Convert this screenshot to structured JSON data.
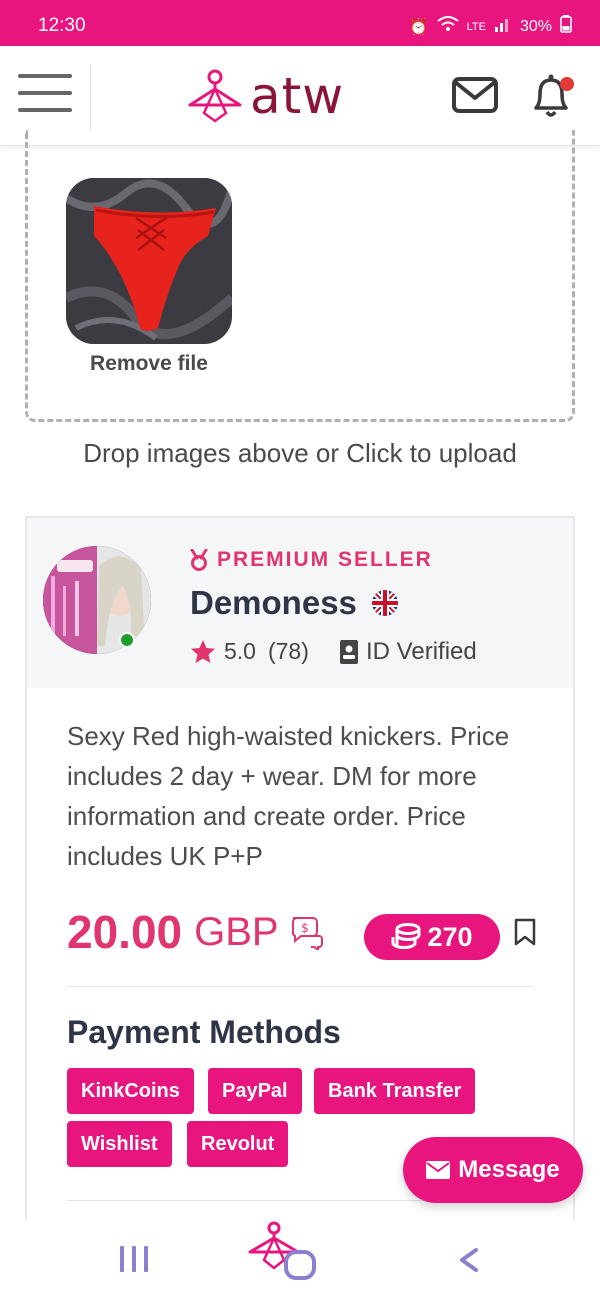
{
  "status_bar": {
    "time": "12:30",
    "network": "LTE",
    "battery": "30%"
  },
  "header": {
    "logo_text": "atw"
  },
  "upload": {
    "remove_label": "Remove file",
    "hint": "Drop images above or Click to upload"
  },
  "seller": {
    "badge": "PREMIUM SELLER",
    "name": "Demoness",
    "rating": "5.0",
    "review_count": "(78)",
    "verified_label": "ID Verified"
  },
  "listing": {
    "description": "Sexy Red high-waisted knickers. Price includes 2 day + wear. DM for more information and create order. Price includes UK P+P",
    "price_amount": "20.00",
    "price_currency": "GBP",
    "coins": "270"
  },
  "payment": {
    "title": "Payment Methods",
    "methods": [
      "KinkCoins",
      "PayPal",
      "Bank Transfer",
      "Wishlist",
      "Revolut"
    ]
  },
  "message_button": "Message",
  "colors": {
    "brand_pink": "#e8157f",
    "price_pink": "#e0356d",
    "logo_maroon": "#8a1538"
  }
}
